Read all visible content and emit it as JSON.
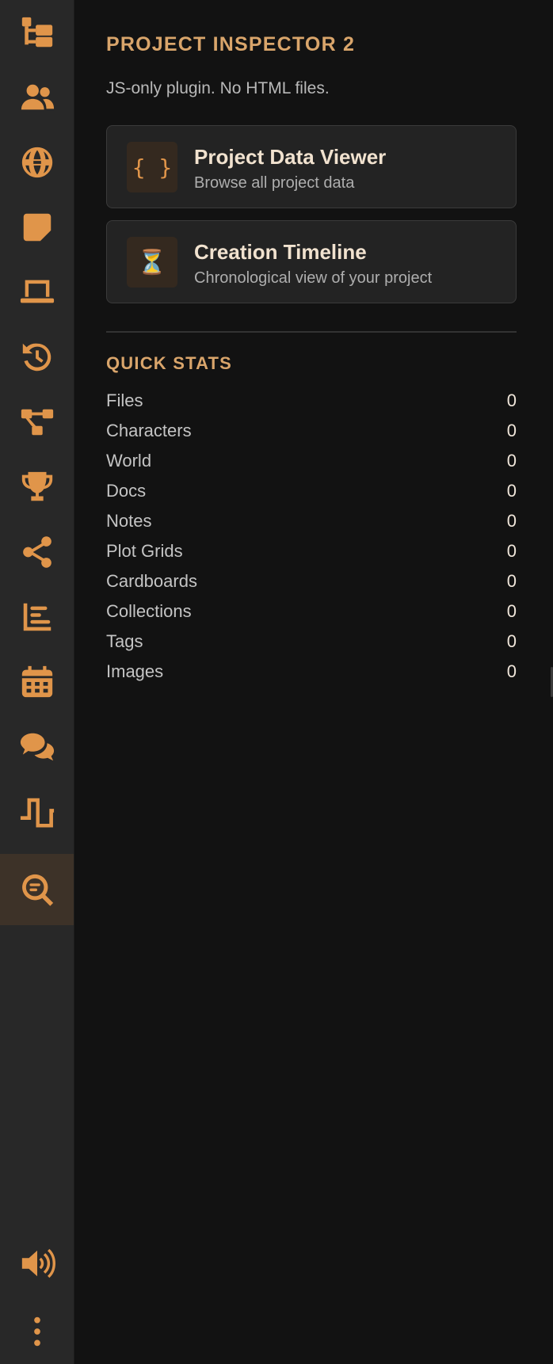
{
  "sidebar": {
    "items": [
      {
        "icon": "file-tree-icon",
        "label": "Files"
      },
      {
        "icon": "users-icon",
        "label": "Characters"
      },
      {
        "icon": "globe-icon",
        "label": "World"
      },
      {
        "icon": "sticky-note-icon",
        "label": "Notes"
      },
      {
        "icon": "laptop-icon",
        "label": "Docs"
      },
      {
        "icon": "history-icon",
        "label": "History"
      },
      {
        "icon": "diagram-icon",
        "label": "Plot Grids"
      },
      {
        "icon": "trophy-icon",
        "label": "Goals"
      },
      {
        "icon": "share-icon",
        "label": "Share"
      },
      {
        "icon": "bar-chart-icon",
        "label": "Stats"
      },
      {
        "icon": "calendar-icon",
        "label": "Calendar"
      },
      {
        "icon": "chat-icon",
        "label": "Chat"
      },
      {
        "icon": "step-wave-icon",
        "label": "Timeline"
      },
      {
        "icon": "search-code-icon",
        "label": "Project Inspector 2",
        "active": true
      }
    ],
    "bottom": [
      {
        "icon": "speaker-icon"
      },
      {
        "icon": "more-vertical-icon"
      }
    ],
    "accent_color": "#e0954a"
  },
  "panel": {
    "title": "PROJECT INSPECTOR 2",
    "subtitle": "JS-only plugin. No HTML files.",
    "cards": [
      {
        "icon": "braces-icon",
        "glyph": "{ }",
        "title": "Project Data Viewer",
        "description": "Browse all project data"
      },
      {
        "icon": "hourglass-icon",
        "glyph": "⏳",
        "title": "Creation Timeline",
        "description": "Chronological view of your project"
      }
    ],
    "stats_title": "QUICK STATS",
    "stats": [
      {
        "label": "Files",
        "value": "0"
      },
      {
        "label": "Characters",
        "value": "0"
      },
      {
        "label": "World",
        "value": "0"
      },
      {
        "label": "Docs",
        "value": "0"
      },
      {
        "label": "Notes",
        "value": "0"
      },
      {
        "label": "Plot Grids",
        "value": "0"
      },
      {
        "label": "Cardboards",
        "value": "0"
      },
      {
        "label": "Collections",
        "value": "0"
      },
      {
        "label": "Tags",
        "value": "0"
      },
      {
        "label": "Images",
        "value": "0"
      }
    ]
  }
}
